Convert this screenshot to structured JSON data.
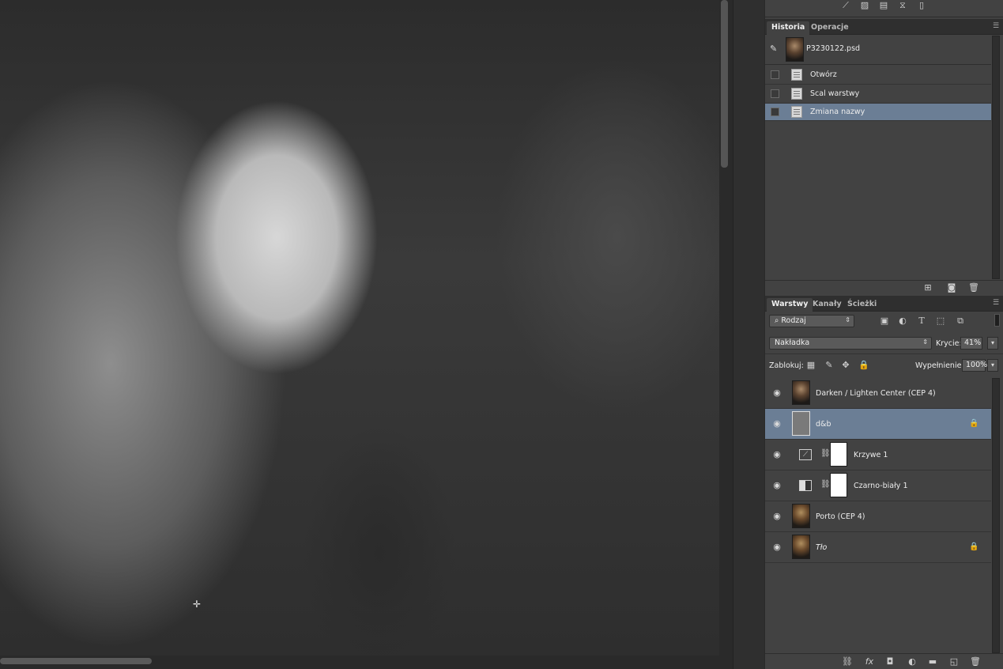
{
  "history": {
    "tabs": [
      {
        "label": "Historia"
      },
      {
        "label": "Operacje"
      }
    ],
    "snapshot": {
      "label": "P3230122.psd"
    },
    "items": [
      {
        "label": "Otwórz"
      },
      {
        "label": "Scal warstwy"
      },
      {
        "label": "Zmiana nazwy",
        "selected": true
      }
    ]
  },
  "layers": {
    "tabs": [
      {
        "label": "Warstwy"
      },
      {
        "label": "Kanały"
      },
      {
        "label": "Ścieżki"
      }
    ],
    "filter": {
      "label": "Rodzaj"
    },
    "blend_mode": {
      "label": "Nakładka"
    },
    "opacity": {
      "label": "Krycie:",
      "value": "41%"
    },
    "lock": {
      "label": "Zablokuj:"
    },
    "fill": {
      "label": "Wypełnienie:",
      "value": "100%"
    },
    "items": [
      {
        "name": "Darken / Lighten Center (CEP 4)"
      },
      {
        "name": "d&b",
        "selected": true,
        "locked": true
      },
      {
        "name": "Krzywe 1"
      },
      {
        "name": "Czarno-biały 1"
      },
      {
        "name": "Porto (CEP 4)"
      },
      {
        "name": "Tło",
        "locked": true
      }
    ]
  },
  "colors": {
    "selection": "#6b7e95",
    "panel_bg": "#424242",
    "tab_bg": "#2f2f2f"
  }
}
